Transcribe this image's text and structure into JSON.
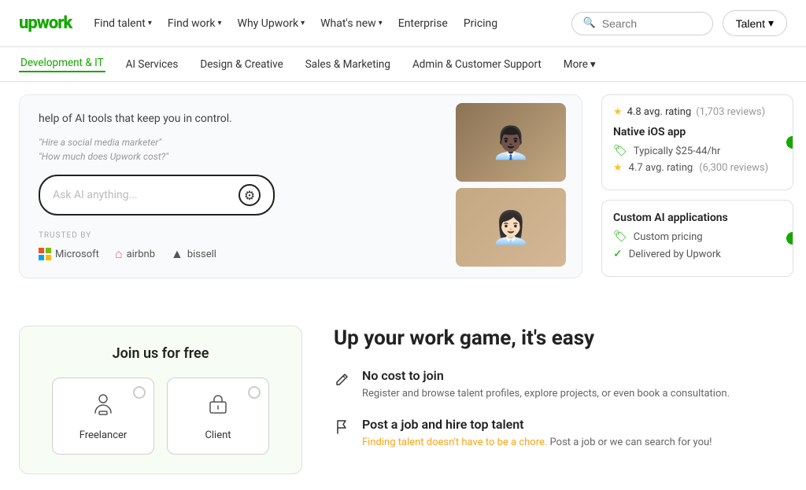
{
  "topNav": {
    "logo": "upwork",
    "items": [
      {
        "label": "Find talent",
        "hasChevron": true
      },
      {
        "label": "Find work",
        "hasChevron": true
      },
      {
        "label": "Why Upwork",
        "hasChevron": true
      },
      {
        "label": "What's new",
        "hasChevron": true
      },
      {
        "label": "Enterprise",
        "hasChevron": false
      },
      {
        "label": "Pricing",
        "hasChevron": false
      }
    ],
    "search": {
      "placeholder": "Search"
    },
    "talentBtn": "Talent"
  },
  "secondNav": {
    "items": [
      {
        "label": "Development & IT",
        "active": true
      },
      {
        "label": "AI Services",
        "active": false
      },
      {
        "label": "Design & Creative",
        "active": false
      },
      {
        "label": "Sales & Marketing",
        "active": false
      },
      {
        "label": "Admin & Customer Support",
        "active": false
      },
      {
        "label": "More",
        "hasChevron": true,
        "active": false
      }
    ]
  },
  "hero": {
    "text": "help of AI tools that keep you in control.",
    "prompts": [
      "\"Hire a social media marketer\"",
      "\"How much does Upwork cost?\""
    ],
    "aiInputPlaceholder": "Ask AI anything...",
    "trustedLabel": "TRUSTED BY",
    "trustedLogos": [
      "Microsoft",
      "airbnb",
      "bissell"
    ]
  },
  "sidebar": {
    "card1": {
      "title": "Native iOS app",
      "pricing": "Typically $25-44/hr",
      "rating": "4.7 avg. rating",
      "reviews": "(6,300 reviews)",
      "topRating": "4.8 avg. rating",
      "topReviews": "(1,703 reviews)"
    },
    "card2": {
      "title": "Custom AI applications",
      "pricing": "Custom pricing",
      "delivery": "Delivered by Upwork"
    }
  },
  "bottomSection": {
    "joinCard": {
      "title": "Join us for free",
      "options": [
        {
          "label": "Freelancer",
          "icon": "👤"
        },
        {
          "label": "Client",
          "icon": "🏢"
        }
      ]
    },
    "rightInfo": {
      "title": "Up your work game, it's easy",
      "items": [
        {
          "icon": "✎",
          "title": "No cost to join",
          "desc": "Register and browse talent profiles, explore projects, or even book a consultation."
        },
        {
          "icon": "⚑",
          "title": "Post a job and hire top talent",
          "desc": "Finding talent doesn't have to be a chore. Post a job or we can search for you!"
        }
      ]
    }
  }
}
